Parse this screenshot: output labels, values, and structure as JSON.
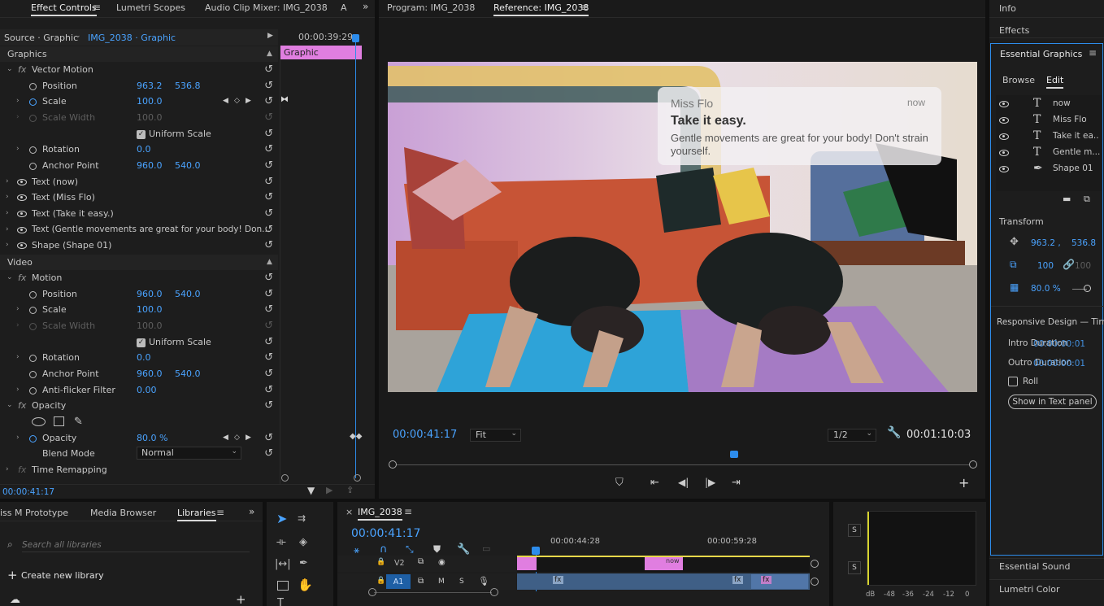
{
  "effect_controls": {
    "tabs": [
      "Effect Controls",
      "Lumetri Scopes",
      "Audio Clip Mixer: IMG_2038",
      "A"
    ],
    "source_label": "Source · Graphic",
    "sequence_label": "IMG_2038 · Graphic",
    "timecode_header": "00:00:39:29",
    "clip_label": "Graphic",
    "graphics_header": "Graphics",
    "vector_motion": "Vector Motion",
    "position_label": "Position",
    "position_x": "963.2",
    "position_y": "536.8",
    "scale_label": "Scale",
    "scale_value": "100.0",
    "scale_width_label": "Scale Width",
    "scale_width_value": "100.0",
    "uniform_scale": "Uniform Scale",
    "rotation_label": "Rotation",
    "rotation_value": "0.0",
    "anchor_label": "Anchor Point",
    "anchor_x": "960.0",
    "anchor_y": "540.0",
    "layers": [
      "Text (now)",
      "Text (Miss Flo)",
      "Text (Take it easy.)",
      "Text (Gentle movements are great for your body! Don...",
      "Shape (Shape 01)"
    ],
    "video_header": "Video",
    "motion": "Motion",
    "m_position_x": "960.0",
    "m_position_y": "540.0",
    "m_scale_value": "100.0",
    "m_scale_width_value": "100.0",
    "m_rotation_value": "0.0",
    "m_anchor_x": "960.0",
    "m_anchor_y": "540.0",
    "antiflicker_label": "Anti-flicker Filter",
    "antiflicker_value": "0.00",
    "opacity_header": "Opacity",
    "opacity_label": "Opacity",
    "opacity_value": "80.0 %",
    "blend_label": "Blend Mode",
    "blend_value": "Normal",
    "time_remap": "Time Remapping",
    "footer_timecode": "00:00:41:17"
  },
  "program": {
    "tab_program": "Program: IMG_2038",
    "tab_reference": "Reference: IMG_2038",
    "notification": {
      "sender": "Miss Flo",
      "time": "now",
      "title": "Take it easy.",
      "body_line1": "Gentle movements are great for your body! Don't strain",
      "body_line2": "yourself."
    },
    "timecode": "00:00:41:17",
    "fit": "Fit",
    "resolution": "1/2",
    "duration": "00:01:10:03"
  },
  "right_panel": {
    "info": "Info",
    "effects": "Effects",
    "essential_graphics": "Essential Graphics",
    "browse": "Browse",
    "edit": "Edit",
    "layers": [
      {
        "icon": "text-icon",
        "label": "now"
      },
      {
        "icon": "text-icon",
        "label": "Miss Flo"
      },
      {
        "icon": "text-icon",
        "label": "Take it ea.."
      },
      {
        "icon": "text-icon",
        "label": "Gentle m..."
      },
      {
        "icon": "pen-icon",
        "label": "Shape 01"
      }
    ],
    "transform": "Transform",
    "pos_x": "963.2 ,",
    "pos_y": "536.8",
    "scale": "100",
    "scale_w": "100",
    "opacity": "80.0 %",
    "responsive": "Responsive Design — Time",
    "intro_label": "Intro Duration",
    "intro_value": "00:00:00:01",
    "outro_label": "Outro Duration",
    "outro_value": "00:00:00:01",
    "roll": "Roll",
    "show_text_panel": "Show in Text panel",
    "essential_sound": "Essential Sound",
    "lumetri_color": "Lumetri Color"
  },
  "project": {
    "tabs": [
      "iss M Prototype",
      "Media Browser",
      "Libraries"
    ],
    "search_placeholder": "Search all libraries",
    "create_library": "Create new library"
  },
  "timeline": {
    "tab": "IMG_2038",
    "timecode": "00:00:41:17",
    "ruler": [
      "00:00:44:28",
      "00:00:59:28"
    ],
    "tracks": [
      "V2",
      "A1"
    ],
    "clip_now": "now",
    "track_buttons": [
      "M",
      "S"
    ]
  },
  "audio_meter": {
    "solo": [
      "S",
      "S"
    ],
    "scale": [
      "dB",
      "-48",
      "-36",
      "-24",
      "-12",
      "0"
    ]
  },
  "colors": {
    "accent_blue": "#2d8ceb",
    "value_blue": "#4aa3ff",
    "clip_pink": "#e07ee0",
    "panel_bg": "#1d1d1d"
  }
}
